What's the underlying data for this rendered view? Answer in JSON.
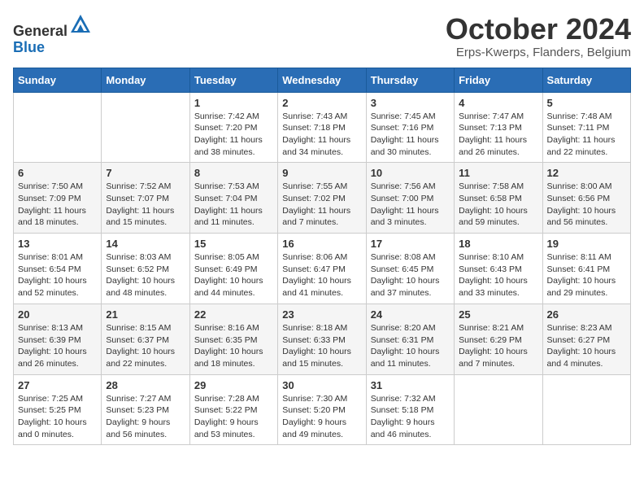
{
  "header": {
    "logo_general": "General",
    "logo_blue": "Blue",
    "month": "October 2024",
    "location": "Erps-Kwerps, Flanders, Belgium"
  },
  "days_of_week": [
    "Sunday",
    "Monday",
    "Tuesday",
    "Wednesday",
    "Thursday",
    "Friday",
    "Saturday"
  ],
  "weeks": [
    [
      {
        "day": "",
        "sunrise": "",
        "sunset": "",
        "daylight": ""
      },
      {
        "day": "",
        "sunrise": "",
        "sunset": "",
        "daylight": ""
      },
      {
        "day": "1",
        "sunrise": "Sunrise: 7:42 AM",
        "sunset": "Sunset: 7:20 PM",
        "daylight": "Daylight: 11 hours and 38 minutes."
      },
      {
        "day": "2",
        "sunrise": "Sunrise: 7:43 AM",
        "sunset": "Sunset: 7:18 PM",
        "daylight": "Daylight: 11 hours and 34 minutes."
      },
      {
        "day": "3",
        "sunrise": "Sunrise: 7:45 AM",
        "sunset": "Sunset: 7:16 PM",
        "daylight": "Daylight: 11 hours and 30 minutes."
      },
      {
        "day": "4",
        "sunrise": "Sunrise: 7:47 AM",
        "sunset": "Sunset: 7:13 PM",
        "daylight": "Daylight: 11 hours and 26 minutes."
      },
      {
        "day": "5",
        "sunrise": "Sunrise: 7:48 AM",
        "sunset": "Sunset: 7:11 PM",
        "daylight": "Daylight: 11 hours and 22 minutes."
      }
    ],
    [
      {
        "day": "6",
        "sunrise": "Sunrise: 7:50 AM",
        "sunset": "Sunset: 7:09 PM",
        "daylight": "Daylight: 11 hours and 18 minutes."
      },
      {
        "day": "7",
        "sunrise": "Sunrise: 7:52 AM",
        "sunset": "Sunset: 7:07 PM",
        "daylight": "Daylight: 11 hours and 15 minutes."
      },
      {
        "day": "8",
        "sunrise": "Sunrise: 7:53 AM",
        "sunset": "Sunset: 7:04 PM",
        "daylight": "Daylight: 11 hours and 11 minutes."
      },
      {
        "day": "9",
        "sunrise": "Sunrise: 7:55 AM",
        "sunset": "Sunset: 7:02 PM",
        "daylight": "Daylight: 11 hours and 7 minutes."
      },
      {
        "day": "10",
        "sunrise": "Sunrise: 7:56 AM",
        "sunset": "Sunset: 7:00 PM",
        "daylight": "Daylight: 11 hours and 3 minutes."
      },
      {
        "day": "11",
        "sunrise": "Sunrise: 7:58 AM",
        "sunset": "Sunset: 6:58 PM",
        "daylight": "Daylight: 10 hours and 59 minutes."
      },
      {
        "day": "12",
        "sunrise": "Sunrise: 8:00 AM",
        "sunset": "Sunset: 6:56 PM",
        "daylight": "Daylight: 10 hours and 56 minutes."
      }
    ],
    [
      {
        "day": "13",
        "sunrise": "Sunrise: 8:01 AM",
        "sunset": "Sunset: 6:54 PM",
        "daylight": "Daylight: 10 hours and 52 minutes."
      },
      {
        "day": "14",
        "sunrise": "Sunrise: 8:03 AM",
        "sunset": "Sunset: 6:52 PM",
        "daylight": "Daylight: 10 hours and 48 minutes."
      },
      {
        "day": "15",
        "sunrise": "Sunrise: 8:05 AM",
        "sunset": "Sunset: 6:49 PM",
        "daylight": "Daylight: 10 hours and 44 minutes."
      },
      {
        "day": "16",
        "sunrise": "Sunrise: 8:06 AM",
        "sunset": "Sunset: 6:47 PM",
        "daylight": "Daylight: 10 hours and 41 minutes."
      },
      {
        "day": "17",
        "sunrise": "Sunrise: 8:08 AM",
        "sunset": "Sunset: 6:45 PM",
        "daylight": "Daylight: 10 hours and 37 minutes."
      },
      {
        "day": "18",
        "sunrise": "Sunrise: 8:10 AM",
        "sunset": "Sunset: 6:43 PM",
        "daylight": "Daylight: 10 hours and 33 minutes."
      },
      {
        "day": "19",
        "sunrise": "Sunrise: 8:11 AM",
        "sunset": "Sunset: 6:41 PM",
        "daylight": "Daylight: 10 hours and 29 minutes."
      }
    ],
    [
      {
        "day": "20",
        "sunrise": "Sunrise: 8:13 AM",
        "sunset": "Sunset: 6:39 PM",
        "daylight": "Daylight: 10 hours and 26 minutes."
      },
      {
        "day": "21",
        "sunrise": "Sunrise: 8:15 AM",
        "sunset": "Sunset: 6:37 PM",
        "daylight": "Daylight: 10 hours and 22 minutes."
      },
      {
        "day": "22",
        "sunrise": "Sunrise: 8:16 AM",
        "sunset": "Sunset: 6:35 PM",
        "daylight": "Daylight: 10 hours and 18 minutes."
      },
      {
        "day": "23",
        "sunrise": "Sunrise: 8:18 AM",
        "sunset": "Sunset: 6:33 PM",
        "daylight": "Daylight: 10 hours and 15 minutes."
      },
      {
        "day": "24",
        "sunrise": "Sunrise: 8:20 AM",
        "sunset": "Sunset: 6:31 PM",
        "daylight": "Daylight: 10 hours and 11 minutes."
      },
      {
        "day": "25",
        "sunrise": "Sunrise: 8:21 AM",
        "sunset": "Sunset: 6:29 PM",
        "daylight": "Daylight: 10 hours and 7 minutes."
      },
      {
        "day": "26",
        "sunrise": "Sunrise: 8:23 AM",
        "sunset": "Sunset: 6:27 PM",
        "daylight": "Daylight: 10 hours and 4 minutes."
      }
    ],
    [
      {
        "day": "27",
        "sunrise": "Sunrise: 7:25 AM",
        "sunset": "Sunset: 5:25 PM",
        "daylight": "Daylight: 10 hours and 0 minutes."
      },
      {
        "day": "28",
        "sunrise": "Sunrise: 7:27 AM",
        "sunset": "Sunset: 5:23 PM",
        "daylight": "Daylight: 9 hours and 56 minutes."
      },
      {
        "day": "29",
        "sunrise": "Sunrise: 7:28 AM",
        "sunset": "Sunset: 5:22 PM",
        "daylight": "Daylight: 9 hours and 53 minutes."
      },
      {
        "day": "30",
        "sunrise": "Sunrise: 7:30 AM",
        "sunset": "Sunset: 5:20 PM",
        "daylight": "Daylight: 9 hours and 49 minutes."
      },
      {
        "day": "31",
        "sunrise": "Sunrise: 7:32 AM",
        "sunset": "Sunset: 5:18 PM",
        "daylight": "Daylight: 9 hours and 46 minutes."
      },
      {
        "day": "",
        "sunrise": "",
        "sunset": "",
        "daylight": ""
      },
      {
        "day": "",
        "sunrise": "",
        "sunset": "",
        "daylight": ""
      }
    ]
  ]
}
